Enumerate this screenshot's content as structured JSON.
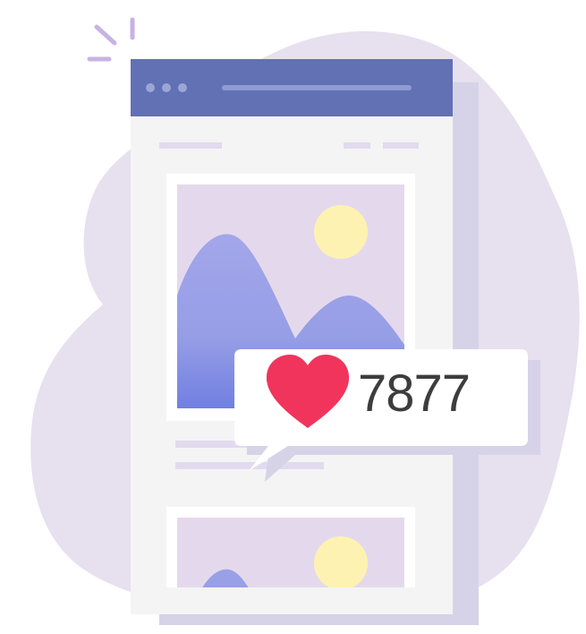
{
  "like_badge": {
    "count": "7877",
    "icon": "heart-icon",
    "heart_color": "#f0345c"
  },
  "colors": {
    "blob": "#e6dfee",
    "window_header": "#6270b4",
    "window_body": "#f4f4f4",
    "window_shadow": "#d5d2e8",
    "photo_bg": "#e4d9ec",
    "sun": "#fdf2b2",
    "mountain": "#9aa0e6",
    "mountain_deep": "#6f7ee0",
    "placeholder_line": "#e0d8ec",
    "sparkle": "#c7b3e4"
  },
  "illustration": {
    "window_icon": "browser-window-icon",
    "photo_icon": "image-placeholder-icon",
    "sparkle_icon": "sparkle-icon"
  }
}
